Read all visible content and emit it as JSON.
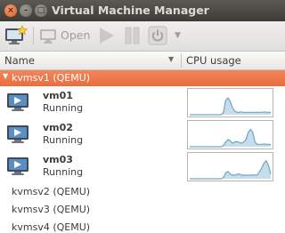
{
  "window": {
    "title": "Virtual Machine Manager"
  },
  "toolbar": {
    "open_label": "Open"
  },
  "list_header": {
    "name_label": "Name",
    "cpu_label": "CPU usage"
  },
  "connections": [
    {
      "label": "kvmsv1 (QEMU)",
      "expanded": true,
      "selected": true,
      "vms": [
        {
          "name": "vm01",
          "state": "Running",
          "cpu": [
            0,
            0,
            0,
            0,
            0,
            0,
            0,
            0,
            0,
            0,
            0,
            0,
            0,
            0,
            0,
            10,
            60,
            70,
            55,
            30,
            15,
            10,
            10,
            12,
            10,
            10,
            10,
            10,
            10,
            10,
            10,
            10,
            10,
            12,
            10,
            10,
            10
          ]
        },
        {
          "name": "vm02",
          "state": "Running",
          "cpu": [
            0,
            0,
            0,
            0,
            0,
            0,
            0,
            0,
            0,
            0,
            0,
            0,
            0,
            0,
            0,
            5,
            20,
            30,
            25,
            15,
            20,
            22,
            18,
            15,
            20,
            30,
            60,
            72,
            60,
            20,
            10,
            10,
            10,
            12,
            10,
            10,
            10
          ]
        },
        {
          "name": "vm03",
          "state": "Running",
          "cpu": [
            0,
            0,
            0,
            0,
            0,
            0,
            0,
            0,
            0,
            0,
            0,
            0,
            0,
            0,
            0,
            5,
            25,
            30,
            20,
            15,
            15,
            18,
            20,
            15,
            15,
            15,
            14,
            15,
            16,
            15,
            15,
            30,
            45,
            65,
            75,
            55,
            20
          ]
        }
      ]
    },
    {
      "label": "kvmsv2 (QEMU)",
      "expanded": false,
      "selected": false
    },
    {
      "label": "kvmsv3 (QEMU)",
      "expanded": false,
      "selected": false
    },
    {
      "label": "kvmsv4 (QEMU)",
      "expanded": false,
      "selected": false
    }
  ],
  "colors": {
    "selection": "#ea6d3e",
    "graph_line": "#6da6c4",
    "graph_fill": "#c7dde9"
  },
  "icons": {
    "new_vm": "monitor-star-icon",
    "open": "monitor-icon",
    "run": "play-icon",
    "pause": "pause-icon",
    "shutdown": "power-icon",
    "vm": "monitor-icon"
  }
}
